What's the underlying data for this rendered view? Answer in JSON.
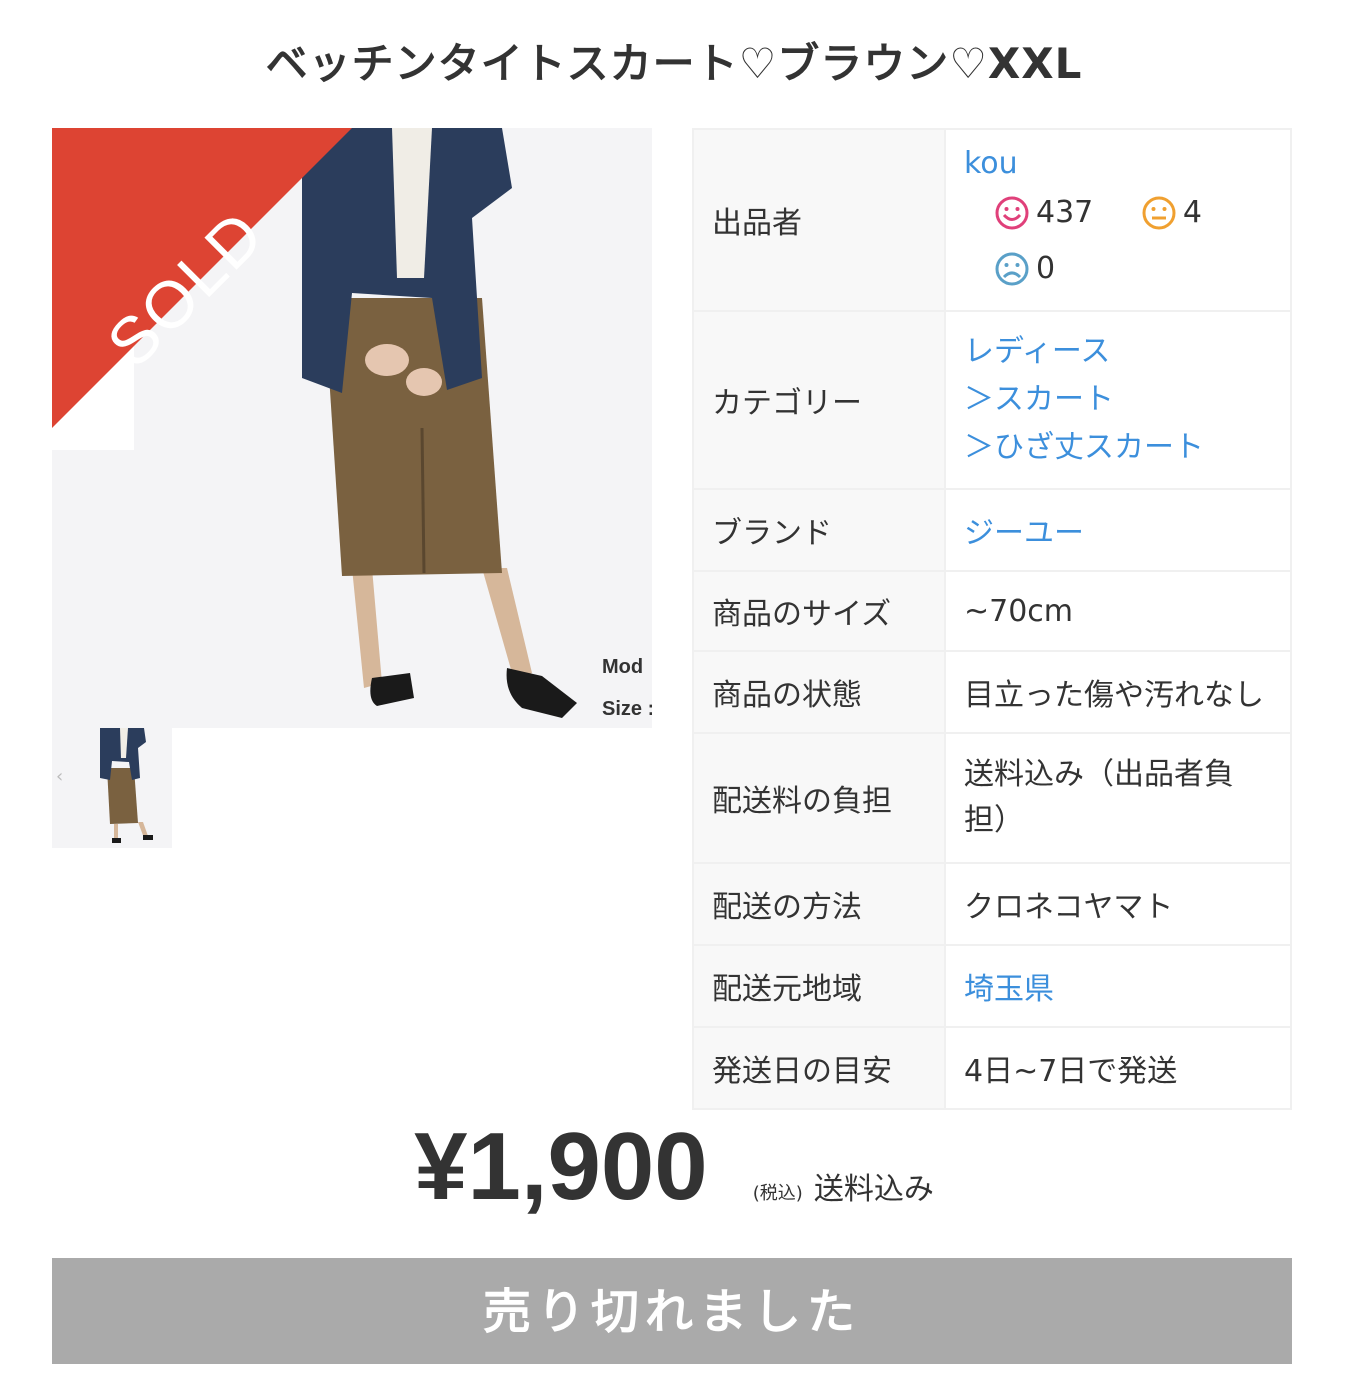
{
  "item": {
    "title": "ベッチンタイトスカート♡ブラウン♡XXL",
    "sold_badge": "SOLD",
    "photo_caption_line1": "Mod",
    "photo_caption_line2": "Size :"
  },
  "details": {
    "seller_label": "出品者",
    "seller_name": "kou",
    "rating_good": "437",
    "rating_normal": "4",
    "rating_bad": "0",
    "category_label": "カテゴリー",
    "category_1": "レディース",
    "category_2": "＞スカート",
    "category_3": "＞ひざ丈スカート",
    "brand_label": "ブランド",
    "brand_value": "ジーユー",
    "size_label": "商品のサイズ",
    "size_value": "~70cm",
    "condition_label": "商品の状態",
    "condition_value": "目立った傷や汚れなし",
    "shipping_fee_label": "配送料の負担",
    "shipping_fee_value": "送料込み（出品者負担）",
    "shipping_method_label": "配送の方法",
    "shipping_method_value": "クロネコヤマト",
    "ship_from_label": "配送元地域",
    "ship_from_value": "埼玉県",
    "ship_days_label": "発送日の目安",
    "ship_days_value": "4日~7日で発送"
  },
  "price": {
    "amount": "¥1,900",
    "tax_note": "(税込)",
    "shipping_note": "送料込み"
  },
  "action": {
    "sold_out_label": "売り切れました"
  },
  "colors": {
    "sold_ribbon": "#dd4433",
    "link": "#3c8fdc",
    "button_disabled": "#aaaaaa",
    "good": "#e0407a",
    "normal": "#f0a030",
    "bad": "#5aa0c8"
  }
}
